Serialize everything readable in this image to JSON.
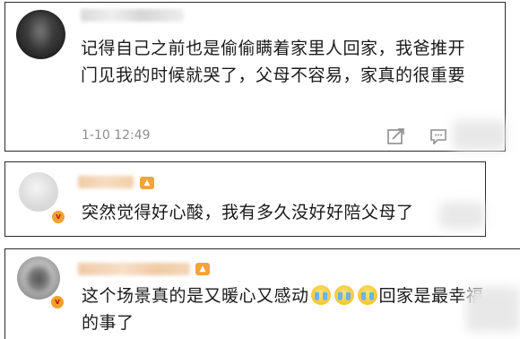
{
  "comments": [
    {
      "text": "记得自己之前也是偷偷瞒着家里人回家，我爸推开门见我的时候就哭了，父母不容易，家真的很重要",
      "timestamp": "1-10 12:49",
      "actions": [
        "share-icon",
        "comment-icon"
      ]
    },
    {
      "text": "突然觉得好心酸，我有多久没好好陪父母了",
      "verified_badge": "v"
    },
    {
      "text_before_emoji": "这个场景真的是又暖心又感动",
      "emoji_name": "crying-face-emoji",
      "emoji_count": 3,
      "text_after_emoji": "回家是最幸福的事了",
      "verified_badge": "v"
    }
  ],
  "colors": {
    "text": "#1a1a1a",
    "timestamp": "#8e8e8e",
    "border": "#2b2b2b",
    "badge": "#f1a12c"
  }
}
